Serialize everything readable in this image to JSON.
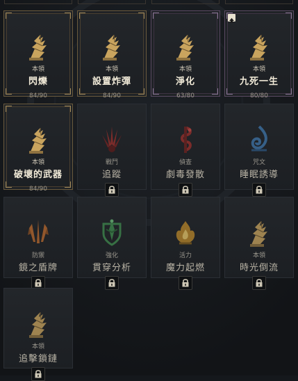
{
  "colors": {
    "gold": "#c9a45e",
    "red": "#9a2f2c",
    "blue": "#3e74a8",
    "green": "#3f8a4e",
    "amber": "#b8862a",
    "orange": "#b8692e",
    "background": "#15181c"
  },
  "skills": [
    {
      "tag": "本領",
      "name": "閃爍",
      "progress": "84/90",
      "state": "unlocked",
      "icon": "winged-boot-icon"
    },
    {
      "tag": "本領",
      "name": "設置炸彈",
      "progress": "84/90",
      "state": "unlocked",
      "icon": "winged-boot-icon"
    },
    {
      "tag": "本領",
      "name": "淨化",
      "progress": "63/80",
      "state": "purple",
      "icon": "winged-boot-icon"
    },
    {
      "tag": "本領",
      "name": "九死一生",
      "progress": "80/80",
      "state": "purple",
      "icon": "winged-boot-icon",
      "badge": "upgrade-arrow-icon"
    },
    {
      "tag": "本領",
      "name": "破壞的武器",
      "progress": "84/90",
      "state": "unlocked",
      "icon": "winged-boot-icon"
    },
    {
      "tag": "戰鬥",
      "name": "追蹤",
      "state": "locked",
      "icon": "blade-fan-icon"
    },
    {
      "tag": "偵查",
      "name": "劇毒發散",
      "state": "locked",
      "icon": "serpent-icon"
    },
    {
      "tag": "咒文",
      "name": "睡眠誘導",
      "state": "locked",
      "icon": "spiral-flame-icon"
    },
    {
      "tag": "防禦",
      "name": "鏡之盾牌",
      "state": "locked",
      "icon": "shield-blades-icon"
    },
    {
      "tag": "強化",
      "name": "貫穿分析",
      "state": "locked",
      "icon": "green-crest-icon"
    },
    {
      "tag": "活力",
      "name": "魔力起燃",
      "state": "locked",
      "icon": "golden-flame-icon"
    },
    {
      "tag": "本領",
      "name": "時光倒流",
      "state": "locked",
      "icon": "winged-boot-icon"
    },
    {
      "tag": "本領",
      "name": "追擊鎖鏈",
      "state": "locked",
      "icon": "winged-boot-icon"
    }
  ]
}
